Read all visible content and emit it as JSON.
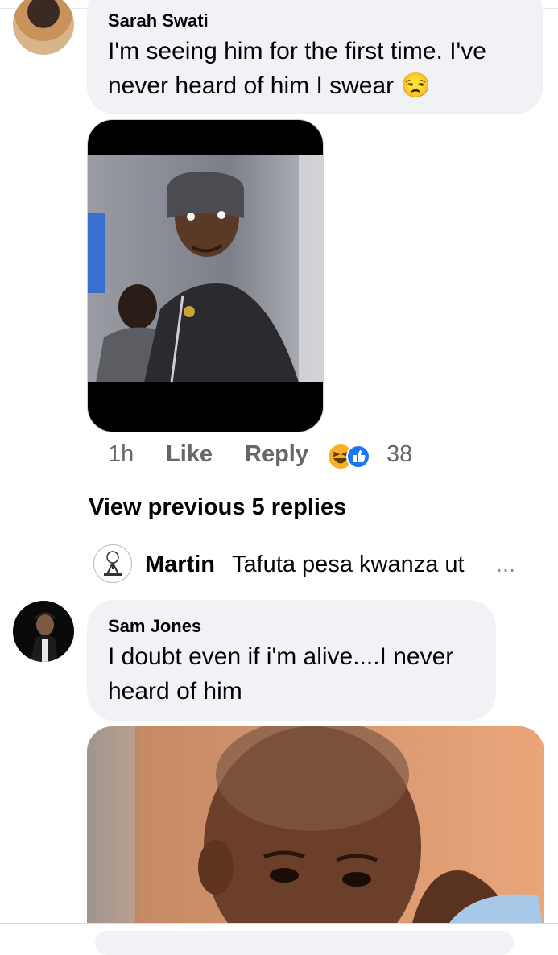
{
  "comments": [
    {
      "author": "Sarah Swati",
      "text_line1": "I'm seeing him for the first time. I've",
      "text_line2": "never heard of him I swear",
      "emoji": "😒"
    },
    {
      "author": "Sam Jones",
      "text_line1": "I doubt even if i'm alive....I never",
      "text_line2": "heard of him"
    }
  ],
  "actions": {
    "time": "1h",
    "like": "Like",
    "reply": "Reply",
    "reaction_count": "38",
    "reaction_icons": [
      "haha-icon",
      "like-icon"
    ]
  },
  "view_previous": "View previous 5 replies",
  "reply_preview": {
    "name": "Martin",
    "text": "Tafuta pesa kwanza ut",
    "ellipsis": "..."
  },
  "colors": {
    "bubble": "#f0f2f5",
    "meta": "#65676b",
    "like_blue": "#1877f2",
    "haha_yellow": "#f7b125"
  }
}
